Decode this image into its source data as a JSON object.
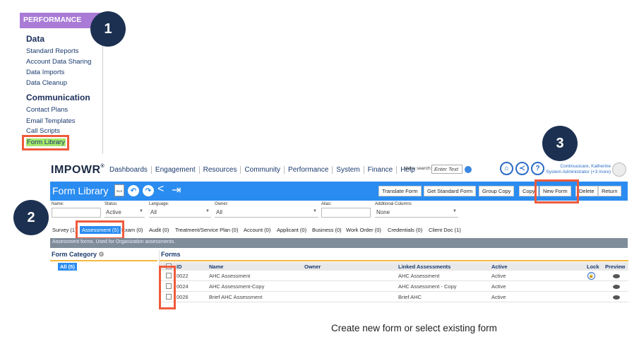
{
  "side_menu": {
    "header": "PERFORMANCE",
    "section_data": "Data",
    "data_items": [
      "Standard Reports",
      "Account Data Sharing",
      "Data Imports",
      "Data Cleanup"
    ],
    "section_comm": "Communication",
    "comm_items": [
      "Contact Plans",
      "Email Templates",
      "Call Scripts",
      "Form Library"
    ]
  },
  "callouts": [
    "1",
    "2",
    "3"
  ],
  "topbar": {
    "logo": "IMPOWR",
    "nav": [
      "Dashboards",
      "Engagement",
      "Resources",
      "Community",
      "Performance",
      "System",
      "Finance",
      "Help"
    ],
    "menu_search_label": "Menu search:",
    "menu_search_placeholder": "Enter Text",
    "user_name": "Continuuicare, Katherine",
    "user_role": "System Administrator (+3 more)"
  },
  "toolbar": {
    "title": "Form Library",
    "xls": "XLS",
    "buttons": [
      "Translate Form",
      "Get Standard Form",
      "Group Copy",
      "Copy",
      "New Form",
      "Delete",
      "Return"
    ]
  },
  "filters": {
    "name_label": "Name:",
    "status_label": "Status:",
    "status_value": "Active",
    "language_label": "Language:",
    "language_value": "All",
    "owner_label": "Owner:",
    "owner_value": "All",
    "alias_label": "Alias:",
    "addcols_label": "Additional Columns",
    "addcols_value": "None"
  },
  "tabs": [
    "Survey (1)",
    "Assessment (5)",
    "Exam (0)",
    "Audit (0)",
    "Treatment/Service Plan (0)",
    "Account (0)",
    "Applicant (0)",
    "Business (0)",
    "Work Order (0)",
    "Credentials (0)",
    "Client Doc (1)"
  ],
  "description": "Assessment forms. Used for Organization assessments.",
  "category": {
    "title": "Form Category",
    "all": "All (5)"
  },
  "forms": {
    "title": "Forms",
    "headers": {
      "id": "ID",
      "name": "Name",
      "owner": "Owner",
      "linked": "Linked Assessments",
      "active": "Active",
      "lock": "Lock",
      "preview": "Preview"
    },
    "rows": [
      {
        "id": "0022",
        "name": "AHC Assessment",
        "linked": "AHC Assessment",
        "active": "Active"
      },
      {
        "id": "0024",
        "name": "AHC Assessment-Copy",
        "linked": "AHC Assessment - Copy",
        "active": "Active"
      },
      {
        "id": "0026",
        "name": "Brief AHC Assessment",
        "linked": "Brief AHC",
        "active": "Active"
      }
    ]
  },
  "caption": "Create new form or select existing form",
  "colors": {
    "brand_blue": "#2a8cf0",
    "callout_red": "#ef5a3c",
    "callout_circle": "#1c3151",
    "perf_purple": "#a97bd6"
  }
}
